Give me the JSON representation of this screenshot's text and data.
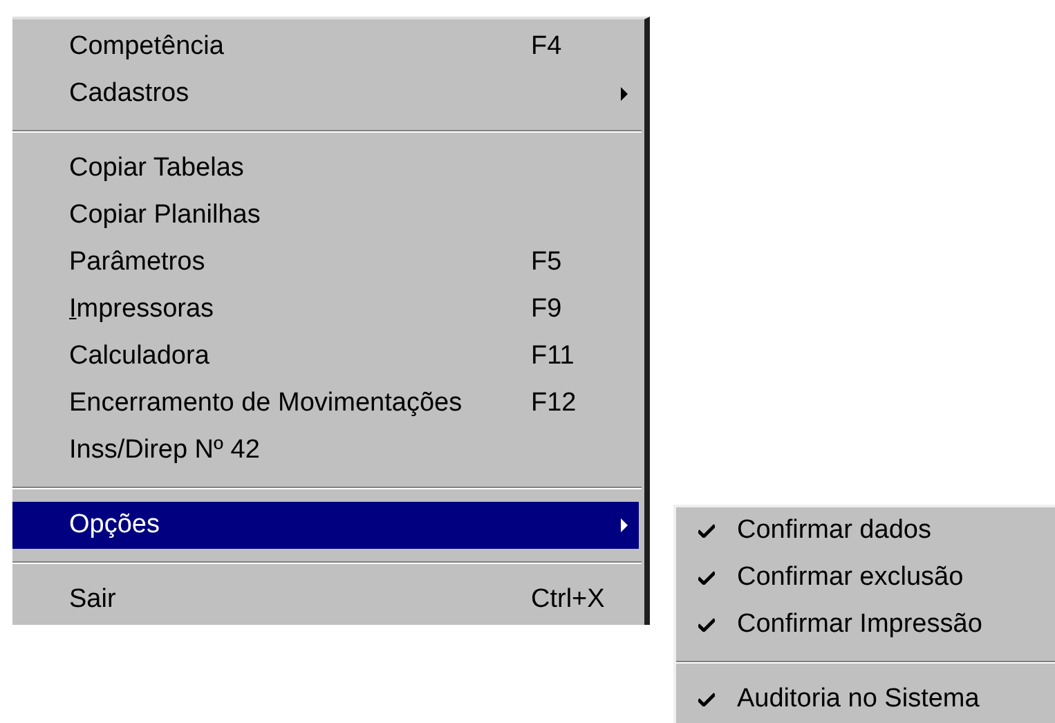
{
  "menu": {
    "items": [
      {
        "kind": "item",
        "label": "Competência",
        "shortcut": "F4",
        "selected": false
      },
      {
        "kind": "item",
        "label": "Cadastros",
        "has_submenu": true,
        "selected": false
      },
      {
        "kind": "separator"
      },
      {
        "kind": "item",
        "label": "Copiar Tabelas",
        "selected": false
      },
      {
        "kind": "item",
        "label": "Copiar Planilhas",
        "selected": false
      },
      {
        "kind": "item",
        "label": "Parâmetros",
        "shortcut": "F5",
        "selected": false
      },
      {
        "kind": "item",
        "label": "Impressoras",
        "shortcut": "F9",
        "mnemonic": true,
        "selected": false
      },
      {
        "kind": "item",
        "label": "Calculadora",
        "shortcut": "F11",
        "selected": false
      },
      {
        "kind": "item",
        "label": "Encerramento de Movimentações",
        "shortcut": "F12",
        "selected": false
      },
      {
        "kind": "item",
        "label": "Inss/Direp Nº 42",
        "selected": false
      },
      {
        "kind": "separator"
      },
      {
        "kind": "item",
        "label": "Opções",
        "has_submenu": true,
        "selected": true
      },
      {
        "kind": "separator"
      },
      {
        "kind": "item",
        "label": "Sair",
        "shortcut": "Ctrl+X",
        "selected": false
      }
    ]
  },
  "submenu": {
    "items": [
      {
        "kind": "item",
        "label": "Confirmar dados",
        "checked": true
      },
      {
        "kind": "item",
        "label": "Confirmar exclusão",
        "checked": true
      },
      {
        "kind": "item",
        "label": "Confirmar Impressão",
        "checked": true
      },
      {
        "kind": "separator"
      },
      {
        "kind": "item",
        "label": "Auditoria no Sistema",
        "checked": true
      }
    ]
  }
}
